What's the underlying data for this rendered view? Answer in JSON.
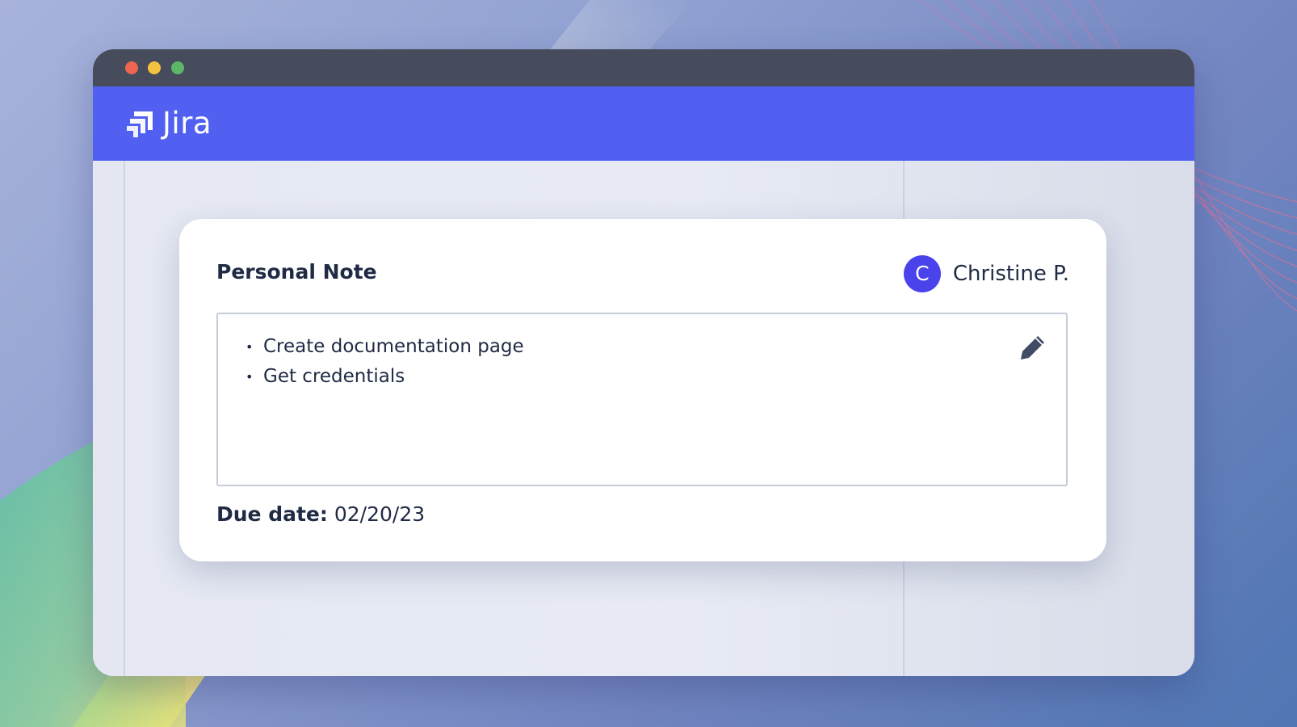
{
  "app": {
    "name": "Jira",
    "brand_color": "#5260f2",
    "titlebar_color": "#474c5d"
  },
  "window_controls": [
    "close",
    "minimize",
    "maximize"
  ],
  "note_card": {
    "title": "Personal Note",
    "user": {
      "initial": "C",
      "name": "Christine P.",
      "avatar_color": "#4a43ec"
    },
    "items": [
      "Create documentation page",
      "Get credentials"
    ],
    "bullet": "•",
    "edit_icon": "pencil-icon",
    "due_label": "Due date:",
    "due_value": "02/20/23"
  }
}
